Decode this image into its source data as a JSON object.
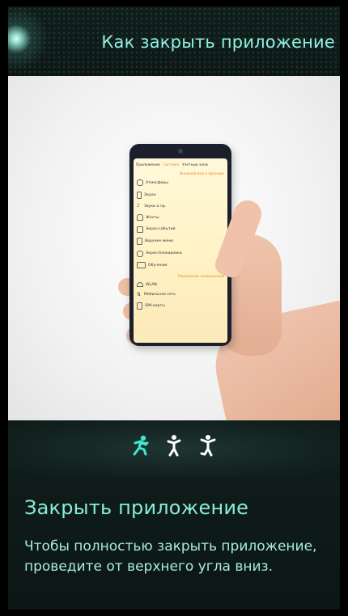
{
  "header": {
    "title": "Как закрыть приложение"
  },
  "phone_screen": {
    "tabs": [
      "Приложения",
      "Система",
      "Учетные запи"
    ],
    "active_tab": "Система",
    "section_appearance": "Внешний вид и функции",
    "appearance_items": [
      {
        "label": "Атмосферы",
        "icon": "palette-icon"
      },
      {
        "label": "Экран",
        "icon": "phone-screen-icon"
      },
      {
        "label": "Звуки и пр.",
        "icon": "music-note-icon"
      },
      {
        "label": "Жесты",
        "icon": "gesture-icon"
      },
      {
        "label": "Экран событий",
        "icon": "event-screen-icon"
      },
      {
        "label": "Верхнее меню",
        "icon": "top-menu-icon"
      },
      {
        "label": "Экран блокировки",
        "icon": "lock-screen-icon"
      },
      {
        "label": "Обучение",
        "icon": "book-icon"
      }
    ],
    "section_network": "Управление соединением",
    "network_items": [
      {
        "label": "WLAN",
        "icon": "wifi-icon"
      },
      {
        "label": "Мобильная сеть",
        "icon": "mobile-network-icon"
      },
      {
        "label": "SIM-карты",
        "icon": "sim-card-icon"
      }
    ]
  },
  "gesture_steps": [
    {
      "name": "gesture-step-1-icon",
      "active": true
    },
    {
      "name": "gesture-step-2-icon",
      "active": false
    },
    {
      "name": "gesture-step-3-icon",
      "active": false
    }
  ],
  "colors": {
    "accent": "#8ff0e1",
    "active_step": "#3ee8cf",
    "inactive_step": "#ffffff"
  },
  "info": {
    "title": "Закрыть приложение",
    "description": "Чтобы полностью закрыть приложение, проведите от верхнего угла вниз."
  }
}
